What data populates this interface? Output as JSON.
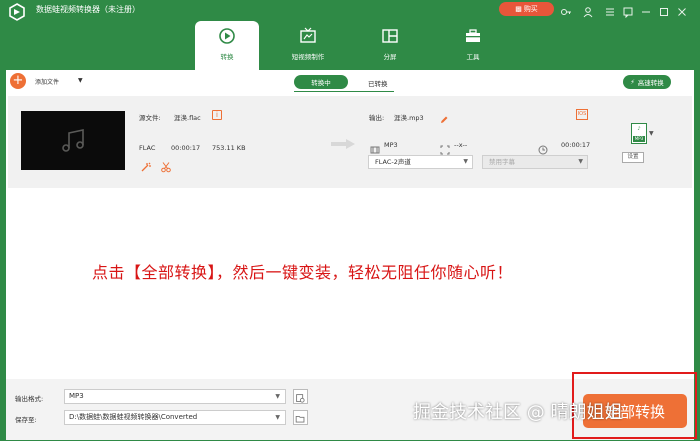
{
  "app": {
    "title": "数据蛙视频转换器（未注册）",
    "buy_label": "购买"
  },
  "tabs": [
    {
      "label": "转换",
      "icon": "convert-icon"
    },
    {
      "label": "短视频制作",
      "icon": "tv-icon"
    },
    {
      "label": "分屏",
      "icon": "split-screen-icon"
    },
    {
      "label": "工具",
      "icon": "toolbox-icon"
    }
  ],
  "toolbar": {
    "add_file": "添加文件",
    "segment_converting": "转换中",
    "segment_converted": "已转换",
    "fast_convert": "高速转换"
  },
  "file": {
    "source_label": "源文件:",
    "source_name": "涯涣.flac",
    "src_format": "FLAC",
    "src_duration": "00:00:17",
    "src_size": "753.11 KB",
    "output_label": "输出:",
    "output_name": "涯涣.mp3",
    "out_format": "MP3",
    "out_resolution": "--x--",
    "out_duration": "00:00:17",
    "audio_track": "FLAC-2声道",
    "subtitle": "禁用字幕",
    "output_icon_label": "MP3",
    "settings_label": "设置"
  },
  "annotation": "点击【全部转换】，然后一键变装，轻松无阻任你随心听！",
  "bottom": {
    "output_format_label": "输出格式:",
    "output_format_value": "MP3",
    "save_to_label": "保存至:",
    "save_to_value": "D:\\数据蛙\\数据蛙视频转换器\\Converted",
    "convert_all": "全部转换"
  },
  "watermark": "掘金技术社区 @ 晴朗姐姐",
  "colors": {
    "brand_green": "#2f8a46",
    "accent_orange": "#ee7036",
    "annotation_red": "#d81515"
  }
}
